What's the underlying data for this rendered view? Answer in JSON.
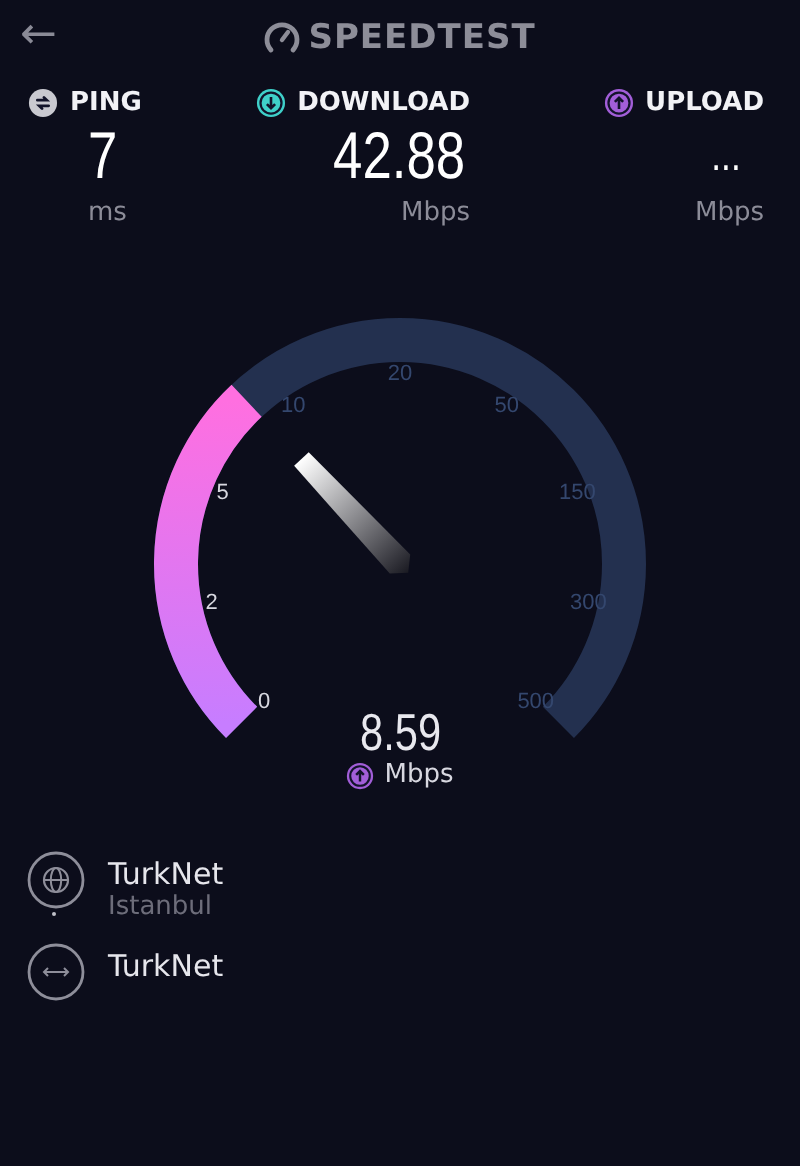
{
  "header": {
    "back": "←",
    "title": "SPEEDTEST"
  },
  "stats": [
    {
      "kind": "ping",
      "label": "PING",
      "value": "7",
      "unit": "ms"
    },
    {
      "kind": "download",
      "label": "DOWNLOAD",
      "value": "42.88",
      "unit": "Mbps"
    },
    {
      "kind": "upload",
      "label": "UPLOAD",
      "value": "...",
      "unit": "Mbps"
    }
  ],
  "gauge": {
    "ticks": [
      "0",
      "2",
      "5",
      "10",
      "20",
      "50",
      "150",
      "300",
      "500"
    ],
    "reading": "8.59",
    "unit": "Mbps"
  },
  "servers": [
    {
      "kind": "globe",
      "name": "TurkNet",
      "location": "Istanbul"
    },
    {
      "kind": "connection",
      "name": "TurkNet"
    }
  ]
}
